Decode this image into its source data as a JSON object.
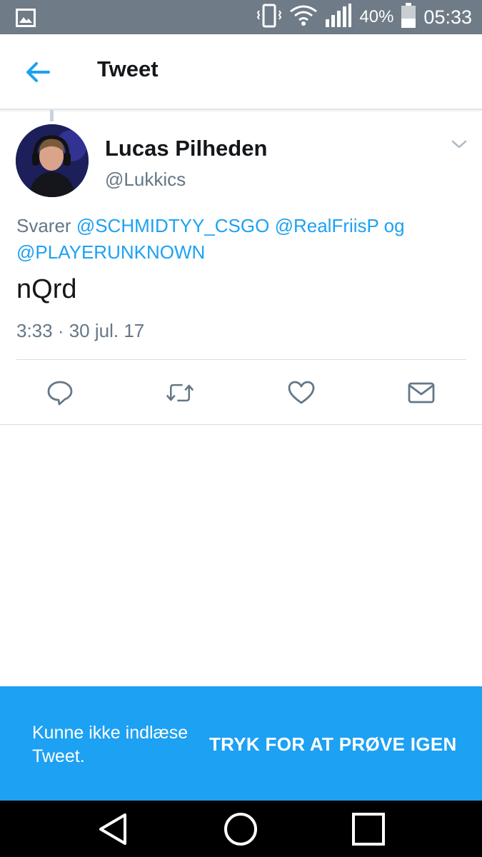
{
  "status_bar": {
    "battery": "40%",
    "time": "05:33",
    "icons": [
      "image-icon",
      "vibrate-icon",
      "wifi-icon",
      "signal-icon",
      "battery-icon"
    ]
  },
  "header": {
    "title": "Tweet",
    "back_icon": "arrow-left-icon"
  },
  "tweet": {
    "name": "Lucas Pilheden",
    "handle": "@Lukkics",
    "reply_prefix": "Svarer",
    "mentions": [
      "@SCHMIDTYY_CSGO",
      "@RealFriisP",
      "@PLAYERUNKNOWN"
    ],
    "reply_joiner": "og",
    "text": "nQrd",
    "timestamp": "3:33 · 30 jul. 17"
  },
  "actions": [
    {
      "name": "reply",
      "icon": "reply-icon"
    },
    {
      "name": "retweet",
      "icon": "retweet-icon"
    },
    {
      "name": "like",
      "icon": "heart-icon"
    },
    {
      "name": "direct-message",
      "icon": "envelope-icon"
    }
  ],
  "error_bar": {
    "message": "Kunne ikke indlæse Tweet.",
    "retry_label": "TRYK FOR AT PRØVE IGEN"
  },
  "nav_bar": {
    "buttons": [
      "back",
      "home",
      "recents"
    ]
  },
  "colors": {
    "accent": "#1da1f2",
    "status_bar": "#6f7b86",
    "secondary_text": "#657786",
    "icon_gray": "#657786"
  }
}
